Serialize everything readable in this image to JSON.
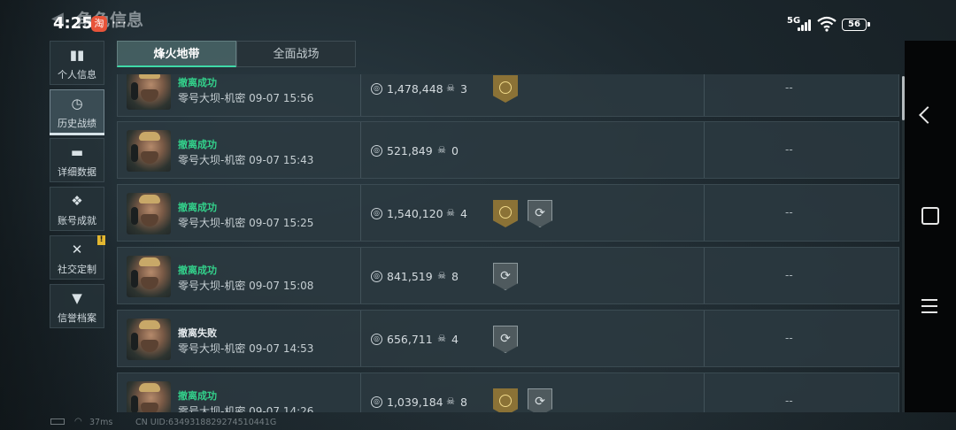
{
  "status_bar": {
    "time": "4:25",
    "notification_badge": "淘",
    "notification_more": "···",
    "network": "5G",
    "battery": "56"
  },
  "header": {
    "title": "角色信息",
    "back_icon": "back-arrow-icon"
  },
  "sidebar": {
    "items": [
      {
        "label": "个人信息",
        "icon": "bar-chart-icon",
        "active": false
      },
      {
        "label": "历史战绩",
        "icon": "clock-icon",
        "active": true
      },
      {
        "label": "详细数据",
        "icon": "folder-icon",
        "active": false
      },
      {
        "label": "账号成就",
        "icon": "medal-icon",
        "active": false
      },
      {
        "label": "社交定制",
        "icon": "tools-icon",
        "active": false,
        "alert": "!"
      },
      {
        "label": "信誉档案",
        "icon": "shield-icon",
        "active": false
      }
    ]
  },
  "tabs": [
    {
      "label": "烽火地带",
      "active": true
    },
    {
      "label": "全面战场",
      "active": false
    }
  ],
  "matches": [
    {
      "result": "撤离成功",
      "status": "success",
      "map": "零号大坝-机密",
      "time": "09-07 15:56",
      "value": "1,478,448",
      "kills": "3",
      "badges": [
        "gold"
      ],
      "extra": "--"
    },
    {
      "result": "撤离成功",
      "status": "success",
      "map": "零号大坝-机密",
      "time": "09-07 15:43",
      "value": "521,849",
      "kills": "0",
      "badges": [],
      "extra": "--"
    },
    {
      "result": "撤离成功",
      "status": "success",
      "map": "零号大坝-机密",
      "time": "09-07 15:25",
      "value": "1,540,120",
      "kills": "4",
      "badges": [
        "gold",
        "silver"
      ],
      "extra": "--"
    },
    {
      "result": "撤离成功",
      "status": "success",
      "map": "零号大坝-机密",
      "time": "09-07 15:08",
      "value": "841,519",
      "kills": "8",
      "badges": [
        "silver"
      ],
      "extra": "--"
    },
    {
      "result": "撤离失败",
      "status": "fail",
      "map": "零号大坝-机密",
      "time": "09-07 14:53",
      "value": "656,711",
      "kills": "4",
      "badges": [
        "silver"
      ],
      "extra": "--"
    },
    {
      "result": "撤离成功",
      "status": "success",
      "map": "零号大坝-机密",
      "time": "09-07 14:26",
      "value": "1,039,184",
      "kills": "8",
      "badges": [
        "gold",
        "silver"
      ],
      "extra": "--"
    }
  ],
  "footer": {
    "ping": "37ms",
    "uid": "CN UID:6349318829274510441G"
  },
  "colors": {
    "success": "#33d18b",
    "accent_tab": "#3fd9a8",
    "gold_badge": "#8b7236",
    "silver_badge": "#4f5a5e"
  }
}
